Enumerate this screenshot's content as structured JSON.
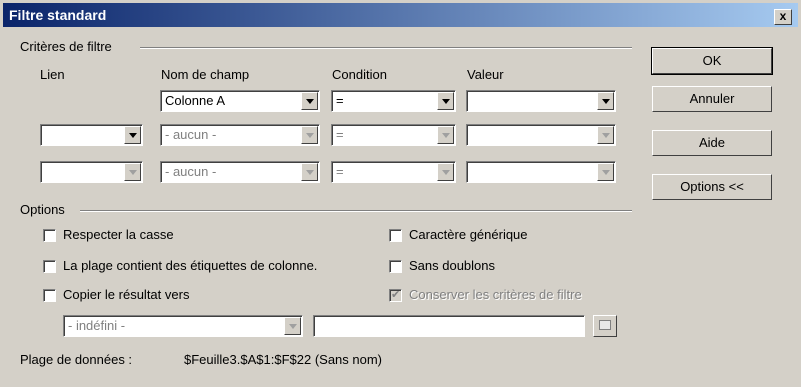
{
  "window": {
    "title": "Filtre standard",
    "close_label": "x"
  },
  "criteria": {
    "section_label": "Critères de filtre",
    "headers": {
      "link": "Lien",
      "field": "Nom de champ",
      "condition": "Condition",
      "value": "Valeur"
    },
    "rows": [
      {
        "link": "",
        "field": "Colonne A",
        "condition": "=",
        "value": ""
      },
      {
        "link": "",
        "field": "- aucun -",
        "condition": "=",
        "value": ""
      },
      {
        "link": "",
        "field": "- aucun -",
        "condition": "=",
        "value": ""
      }
    ]
  },
  "buttons": {
    "ok": "OK",
    "cancel": "Annuler",
    "help": "Aide",
    "options": "Options <<"
  },
  "options": {
    "section_label": "Options",
    "case_sensitive": {
      "label": "Respecter la casse",
      "checked": false
    },
    "range_has_headers": {
      "label": "La plage contient des étiquettes de colonne.",
      "checked": false
    },
    "copy_results": {
      "label": "Copier le résultat vers",
      "checked": false
    },
    "regex": {
      "label": "Caractère générique",
      "checked": false
    },
    "no_duplicates": {
      "label": "Sans doublons",
      "checked": false
    },
    "keep_criteria": {
      "label": "Conserver les critères de filtre",
      "checked": true,
      "disabled": true
    },
    "copy_target_select": "- indéfini -",
    "copy_target_input": ""
  },
  "data_range": {
    "label": "Plage de données :",
    "value": "$Feuille3.$A$1:$F$22 (Sans nom)"
  }
}
